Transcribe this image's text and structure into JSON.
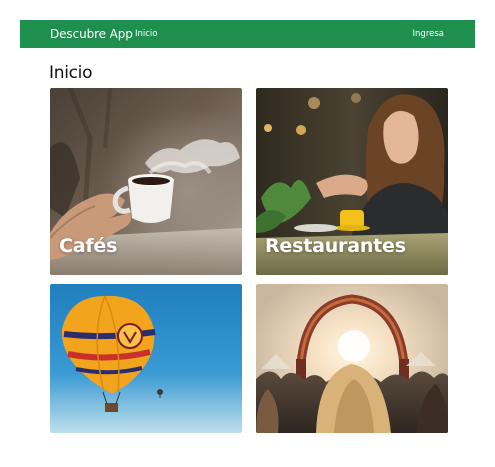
{
  "navbar": {
    "brand": "Descubre App",
    "home_link": "Inicio",
    "login_link": "Ingresa"
  },
  "page": {
    "title": "Inicio"
  },
  "cards": [
    {
      "label": "Cafés"
    },
    {
      "label": "Restaurantes"
    },
    {
      "label": ""
    },
    {
      "label": ""
    }
  ],
  "colors": {
    "navbar_bg": "#1e8f4e",
    "page_bg": "#ffffff"
  }
}
